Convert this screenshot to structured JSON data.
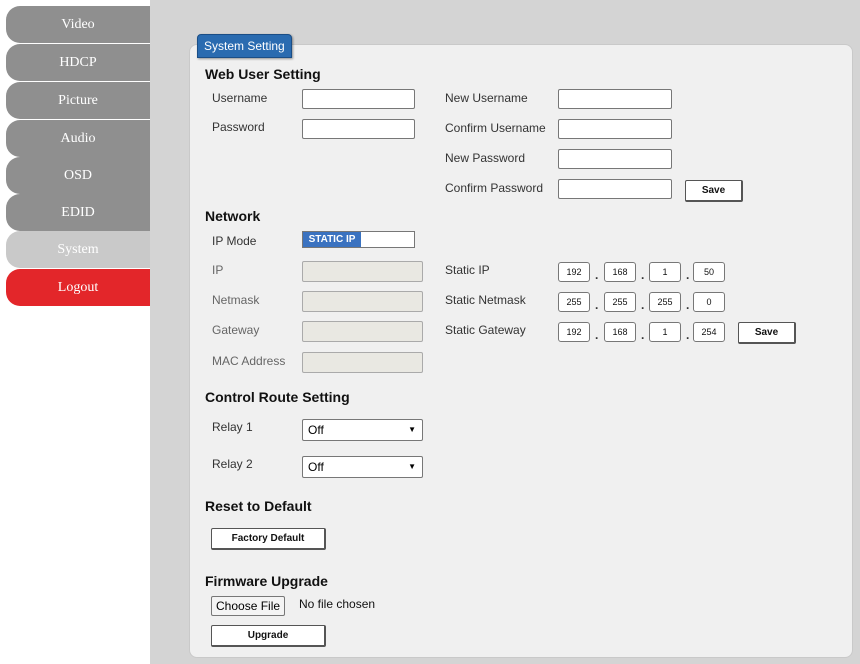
{
  "sidebar": {
    "items": [
      {
        "label": "Video"
      },
      {
        "label": "HDCP"
      },
      {
        "label": "Picture"
      },
      {
        "label": "Audio"
      },
      {
        "label": "OSD"
      },
      {
        "label": "EDID"
      },
      {
        "label": "System"
      },
      {
        "label": "Logout"
      }
    ],
    "active": "System"
  },
  "panel": {
    "tab_label": "System Setting"
  },
  "web_user": {
    "title": "Web User Setting",
    "username_label": "Username",
    "password_label": "Password",
    "new_username_label": "New Username",
    "confirm_username_label": "Confirm Username",
    "new_password_label": "New Password",
    "confirm_password_label": "Confirm Password",
    "save_label": "Save"
  },
  "network": {
    "title": "Network",
    "ip_mode_label": "IP Mode",
    "ip_mode_value": "STATIC IP",
    "ip_label": "IP",
    "netmask_label": "Netmask",
    "gateway_label": "Gateway",
    "mac_label": "MAC Address",
    "static_ip_label": "Static IP",
    "static_netmask_label": "Static Netmask",
    "static_gateway_label": "Static Gateway",
    "static_ip": [
      "192",
      "168",
      "1",
      "50"
    ],
    "static_netmask": [
      "255",
      "255",
      "255",
      "0"
    ],
    "static_gateway": [
      "192",
      "168",
      "1",
      "254"
    ],
    "dot": ".",
    "save_label": "Save"
  },
  "control_route": {
    "title": "Control Route Setting",
    "relay1_label": "Relay 1",
    "relay1_value": "Off",
    "relay2_label": "Relay 2",
    "relay2_value": "Off",
    "arrow": "▼"
  },
  "reset": {
    "title": "Reset to Default",
    "button_label": "Factory Default"
  },
  "firmware": {
    "title": "Firmware Upgrade",
    "choose_file_label": "Choose File",
    "no_file_text": "No file chosen",
    "upgrade_label": "Upgrade"
  },
  "colors": {
    "sidebar_normal": "#8f8f8f",
    "sidebar_active": "#c9c9c9",
    "logout": "#e3262a",
    "tab": "#2a6bb0",
    "toggle_on": "#3a72c0"
  }
}
